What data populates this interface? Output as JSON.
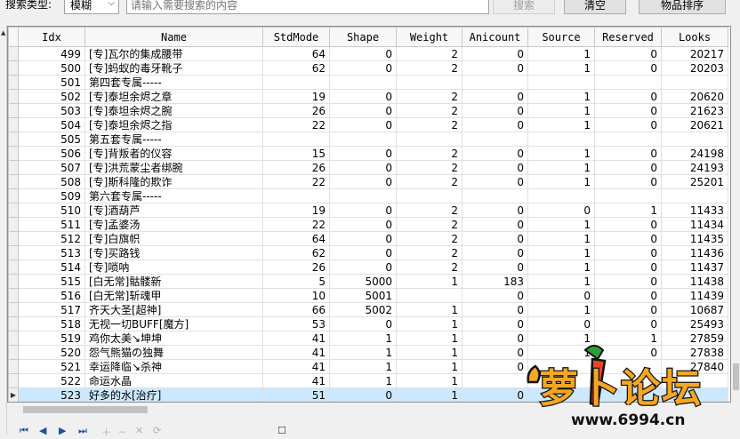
{
  "toolbar": {
    "search_type_label": "搜索类型:",
    "search_type_value": "模糊",
    "search_placeholder": "请输入需要搜索的内容",
    "search_button": "搜索",
    "clear_button": "清空",
    "sort_button": "物品排序"
  },
  "table": {
    "columns": [
      "Idx",
      "Name",
      "StdMode",
      "Shape",
      "Weight",
      "Anicount",
      "Source",
      "Reserved",
      "Looks"
    ],
    "rows": [
      [
        "499",
        "[专]瓦尔的集成腰带",
        "64",
        "0",
        "2",
        "0",
        "1",
        "0",
        "20217"
      ],
      [
        "500",
        "[专]蚂蚁的毒牙靴子",
        "62",
        "0",
        "2",
        "0",
        "1",
        "0",
        "20203"
      ],
      [
        "501",
        "第四套专属-----",
        "",
        "",
        "",
        "",
        "",
        "",
        ""
      ],
      [
        "502",
        "[专]泰坦余烬之章",
        "19",
        "0",
        "2",
        "0",
        "1",
        "0",
        "20620"
      ],
      [
        "503",
        "[专]泰坦余烬之腕",
        "26",
        "0",
        "2",
        "0",
        "1",
        "0",
        "21623"
      ],
      [
        "504",
        "[专]泰坦余烬之指",
        "22",
        "0",
        "2",
        "0",
        "1",
        "0",
        "20621"
      ],
      [
        "505",
        "第五套专属-----",
        "",
        "",
        "",
        "",
        "",
        "",
        ""
      ],
      [
        "506",
        "[专]背叛者的仪容",
        "15",
        "0",
        "2",
        "0",
        "1",
        "0",
        "24198"
      ],
      [
        "507",
        "[专]洪荒蒙尘者绑腕",
        "26",
        "0",
        "2",
        "0",
        "1",
        "0",
        "24193"
      ],
      [
        "508",
        "[专]斯科隆的欺诈",
        "22",
        "0",
        "2",
        "0",
        "1",
        "0",
        "25201"
      ],
      [
        "509",
        "第六套专属-----",
        "",
        "",
        "",
        "",
        "",
        "",
        ""
      ],
      [
        "510",
        "[专]酒葫芦",
        "19",
        "0",
        "2",
        "0",
        "0",
        "1",
        "11433"
      ],
      [
        "511",
        "[专]孟婆汤",
        "22",
        "0",
        "2",
        "0",
        "1",
        "0",
        "11434"
      ],
      [
        "512",
        "[专]白旗帜",
        "64",
        "0",
        "2",
        "0",
        "1",
        "0",
        "11435"
      ],
      [
        "513",
        "[专]买路钱",
        "62",
        "0",
        "2",
        "0",
        "1",
        "0",
        "11436"
      ],
      [
        "514",
        "[专]唢呐",
        "26",
        "0",
        "2",
        "0",
        "1",
        "0",
        "11437"
      ],
      [
        "515",
        "[白无常]骷髅新",
        "5",
        "5000",
        "1",
        "183",
        "1",
        "0",
        "11438"
      ],
      [
        "516",
        "[白无常]斩魂甲",
        "10",
        "5001",
        "",
        "0",
        "0",
        "0",
        "11439"
      ],
      [
        "517",
        "齐天大圣[超神]",
        "66",
        "5002",
        "1",
        "0",
        "1",
        "0",
        "10687"
      ],
      [
        "518",
        "无视一切BUFF[魔方]",
        "53",
        "0",
        "1",
        "0",
        "0",
        "0",
        "25493"
      ],
      [
        "519",
        "鸡你太美↘坤坤",
        "41",
        "1",
        "1",
        "0",
        "1",
        "1",
        "27859"
      ],
      [
        "520",
        "怨气熊猫の独舞",
        "41",
        "1",
        "1",
        "0",
        "1",
        "0",
        "27838"
      ],
      [
        "521",
        "幸运降临↘杀神",
        "41",
        "1",
        "1",
        "0",
        "",
        "",
        "27840"
      ],
      [
        "522",
        "命运水晶",
        "41",
        "1",
        "1",
        "",
        "",
        "",
        ""
      ],
      [
        "523",
        "好多的水[治疗]",
        "51",
        "0",
        "1",
        "0",
        "",
        "",
        ""
      ]
    ],
    "selected_idx": "523"
  },
  "watermark": {
    "brand_text": "萝卜论坛",
    "url_text": "www.6994.cn"
  },
  "colors": {
    "selection": "#cce8ff",
    "logo_fill": "#f5a623",
    "logo_outline": "#111111"
  }
}
